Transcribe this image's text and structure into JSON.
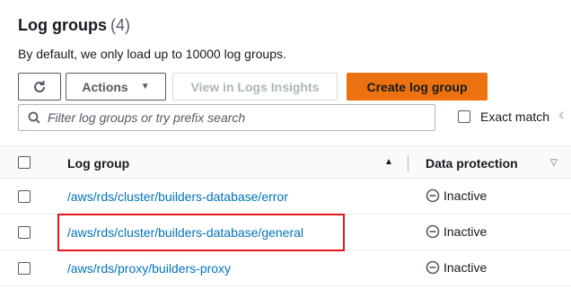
{
  "header": {
    "title": "Log groups",
    "count": "(4)",
    "subtitle": "By default, we only load up to 10000 log groups."
  },
  "toolbar": {
    "refresh_icon": "refresh-icon",
    "actions_label": "Actions",
    "insights_label": "View in Logs Insights",
    "create_label": "Create log group"
  },
  "search": {
    "placeholder": "Filter log groups or try prefix search",
    "exact_match_label": "Exact match"
  },
  "table": {
    "columns": [
      "Log group",
      "Data protection"
    ],
    "rows": [
      {
        "name": "/aws/rds/cluster/builders-database/error",
        "protection": "Inactive"
      },
      {
        "name": "/aws/rds/cluster/builders-database/general",
        "protection": "Inactive"
      },
      {
        "name": "/aws/rds/proxy/builders-proxy",
        "protection": "Inactive"
      }
    ]
  },
  "colors": {
    "accent_orange": "#ec7211",
    "link_blue": "#0073bb",
    "highlight_red": "#e8161a"
  }
}
